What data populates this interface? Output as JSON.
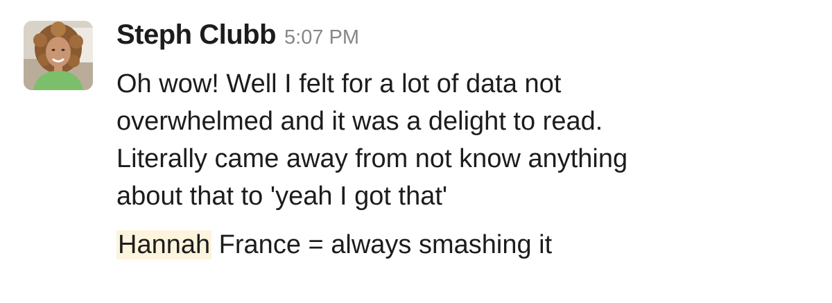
{
  "message": {
    "author": "Steph Clubb",
    "timestamp": "5:07 PM",
    "paragraph1_lines": [
      "Oh wow! Well I felt for a lot of data not",
      "overwhelmed and it was a delight to read.",
      "Literally came away from not know anything",
      "about that to 'yeah I got that'"
    ],
    "paragraph2": {
      "mention": "Hannah",
      "rest": " France = always smashing it"
    }
  },
  "colors": {
    "text": "#1d1c1d",
    "timestamp": "#868686",
    "mention_highlight": "#fcf4dc"
  }
}
